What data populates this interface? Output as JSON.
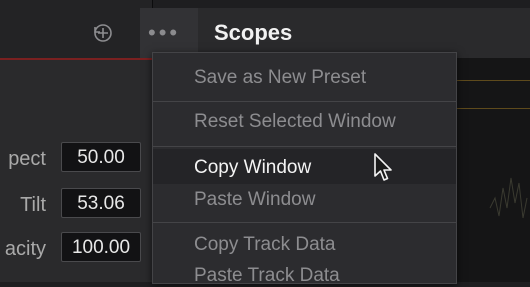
{
  "left_panel": {
    "properties": [
      {
        "label": "pect",
        "value": "50.00"
      },
      {
        "label": "Tilt",
        "value": "53.06"
      },
      {
        "label": "acity",
        "value": "100.00"
      }
    ]
  },
  "header": {
    "more_icon": "more-options-icon",
    "title": "Scopes"
  },
  "menu": {
    "items": [
      "Save as New Preset",
      "Reset Selected Window",
      "Copy Window",
      "Paste Window",
      "Copy Track Data",
      "Paste Track Data"
    ],
    "highlighted": "Copy Window"
  },
  "colors": {
    "accent_red": "#7a2020",
    "scope_trace": "#5e4a1c"
  }
}
